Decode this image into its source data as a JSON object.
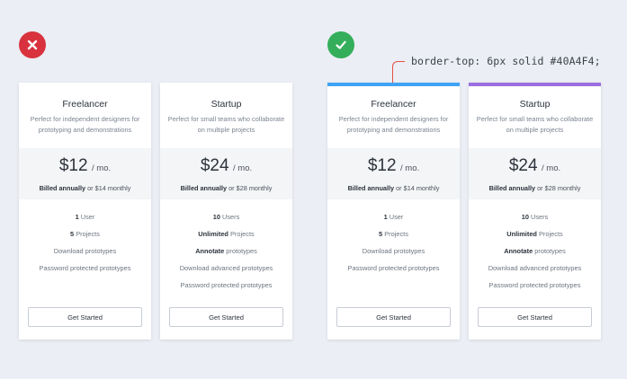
{
  "annotation": {
    "code": "border-top: 6px solid #40A4F4;"
  },
  "colors": {
    "bad": "#d9323f",
    "good": "#34ae5a",
    "blue_border": "#40A4F4",
    "purple_border": "#9b6fe0"
  },
  "plans": {
    "freelancer": {
      "name": "Freelancer",
      "desc1": "Perfect for independent designers for",
      "desc2": "prototyping and demonstrations",
      "price": "$12",
      "unit": "/ mo.",
      "billed_bold": "Billed annually",
      "billed_rest": " or $14 monthly",
      "f1_bold": "1",
      "f1_rest": " User",
      "f2_bold": "5",
      "f2_rest": " Projects",
      "f3": "Download prototypes",
      "f4": "Password  protected prototypes",
      "cta": "Get Started"
    },
    "startup": {
      "name": "Startup",
      "desc1": "Perfect for small teams who collaborate",
      "desc2": "on multiple projects",
      "price": "$24",
      "unit": "/ mo.",
      "billed_bold": "Billed annually",
      "billed_rest": " or $28 monthly",
      "f1_bold": "10",
      "f1_rest": " Users",
      "f2_bold": "Unlimited",
      "f2_rest": " Projects",
      "f3_bold": "Annotate",
      "f3_rest": " prototypes",
      "f4": "Download advanced prototypes",
      "f5": "Password protected prototypes",
      "cta": "Get Started"
    }
  }
}
